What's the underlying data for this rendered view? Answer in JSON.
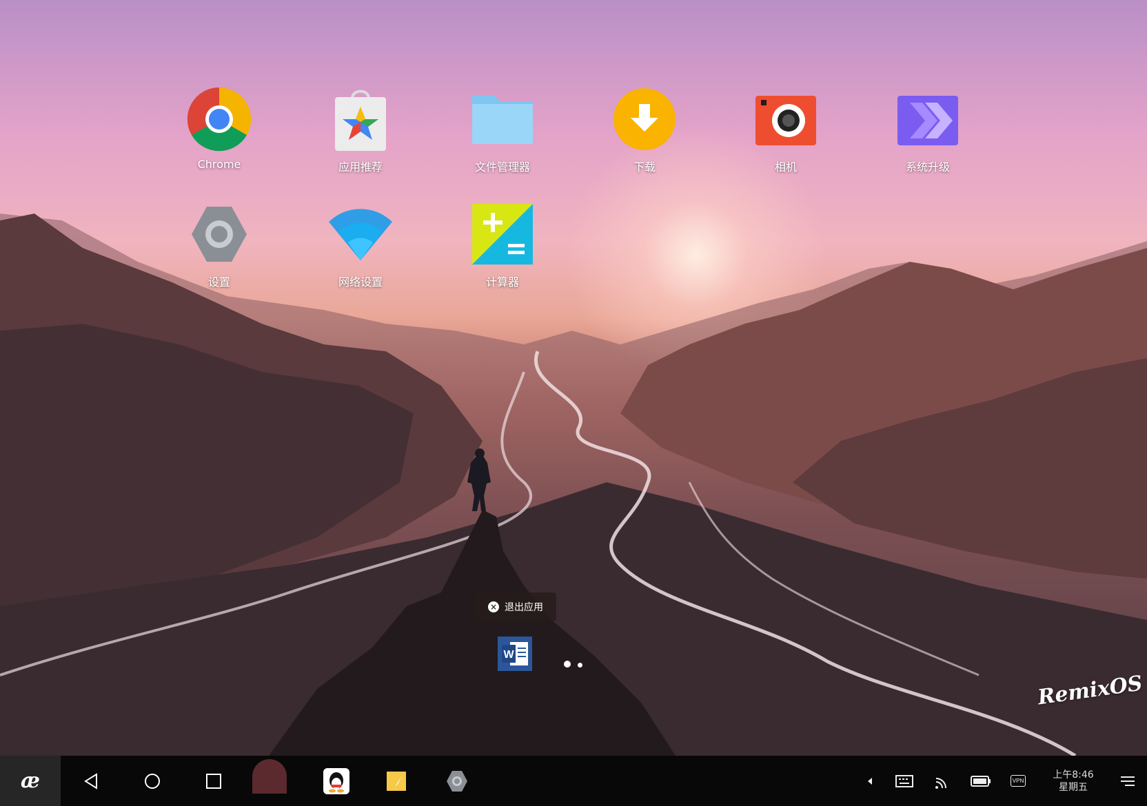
{
  "desktop": {
    "apps_row1": [
      {
        "label": "Chrome",
        "icon": "chrome-icon"
      },
      {
        "label": "应用推荐",
        "icon": "app-store-icon"
      },
      {
        "label": "文件管理器",
        "icon": "folder-icon"
      },
      {
        "label": "下载",
        "icon": "download-icon"
      },
      {
        "label": "相机",
        "icon": "camera-icon"
      },
      {
        "label": "系统升级",
        "icon": "system-update-icon"
      }
    ],
    "apps_row2": [
      {
        "label": "设置",
        "icon": "settings-icon"
      },
      {
        "label": "网络设置",
        "icon": "wifi-icon"
      },
      {
        "label": "计算器",
        "icon": "calculator-icon"
      }
    ],
    "exit_tooltip": "退出应用",
    "dock_app": "word-icon",
    "brand": "RemixOS"
  },
  "taskbar": {
    "start_label": "æ",
    "clock_time": "上午8:46",
    "clock_day": "星期五",
    "nav": [
      "back-icon",
      "home-icon",
      "recents-icon"
    ],
    "pinned": [
      "avatar-app-icon",
      "qq-icon",
      "notes-icon",
      "settings-gear-icon"
    ],
    "tray": [
      "arrow-left-icon",
      "keyboard-icon",
      "cast-icon",
      "battery-icon",
      "vpn-icon",
      "menu-icon"
    ],
    "vpn_label": "VPN"
  }
}
